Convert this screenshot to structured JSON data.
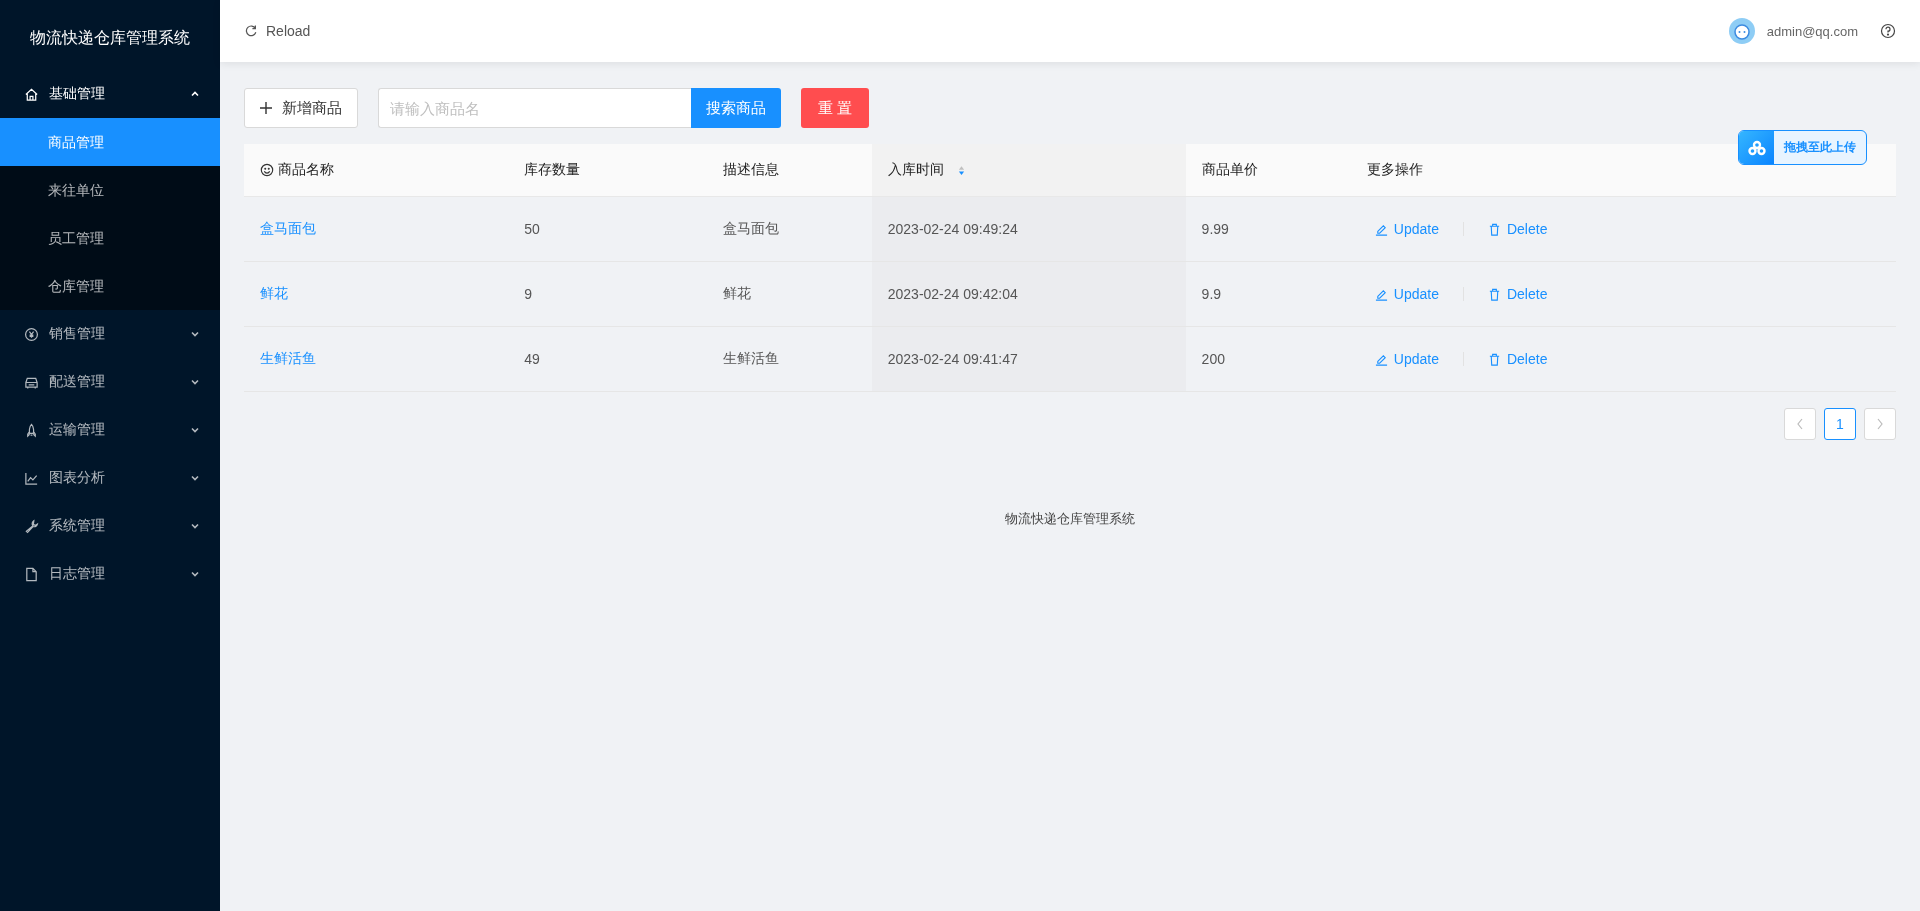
{
  "sidebar": {
    "title": "物流快递仓库管理系统",
    "menu": [
      {
        "label": "基础管理",
        "kind": "home",
        "expanded": true,
        "children": [
          {
            "label": "商品管理",
            "selected": true
          },
          {
            "label": "来往单位",
            "selected": false
          },
          {
            "label": "员工管理",
            "selected": false
          },
          {
            "label": "仓库管理",
            "selected": false
          }
        ]
      },
      {
        "label": "销售管理",
        "kind": "yen",
        "expanded": false
      },
      {
        "label": "配送管理",
        "kind": "car",
        "expanded": false
      },
      {
        "label": "运输管理",
        "kind": "rocket",
        "expanded": false
      },
      {
        "label": "图表分析",
        "kind": "chart",
        "expanded": false
      },
      {
        "label": "系统管理",
        "kind": "wrench",
        "expanded": false
      },
      {
        "label": "日志管理",
        "kind": "file",
        "expanded": false
      }
    ]
  },
  "header": {
    "reload": "Reload",
    "user": "admin@qq.com"
  },
  "toolbar": {
    "add_button": "新增商品",
    "search": {
      "placeholder": "请输入商品名"
    },
    "search_button": "搜索商品",
    "reset_button": "重 置"
  },
  "upload_widget": {
    "label": "拖拽至此上传"
  },
  "table": {
    "columns": [
      {
        "label": "商品名称",
        "kind": "smile"
      },
      {
        "label": "库存数量",
        "kind": "plain"
      },
      {
        "label": "描述信息",
        "kind": "plain"
      },
      {
        "label": "入库时间",
        "kind": "sortable"
      },
      {
        "label": "商品单价",
        "kind": "plain"
      },
      {
        "label": "更多操作",
        "kind": "plain"
      }
    ],
    "rows": [
      {
        "cells": [
          "盒马面包",
          "50",
          "盒马面包",
          "2023-02-24 09:49:24",
          "9.99"
        ],
        "actions": [
          {
            "label": "Update",
            "kind": "edit"
          },
          {
            "label": "Delete",
            "kind": "delete"
          }
        ]
      },
      {
        "cells": [
          "鲜花",
          "9",
          "鲜花",
          "2023-02-24 09:42:04",
          "9.9"
        ],
        "actions": [
          {
            "label": "Update",
            "kind": "edit"
          },
          {
            "label": "Delete",
            "kind": "delete"
          }
        ]
      },
      {
        "cells": [
          "生鲜活鱼",
          "49",
          "生鲜活鱼",
          "2023-02-24 09:41:47",
          "200"
        ],
        "actions": [
          {
            "label": "Update",
            "kind": "edit"
          },
          {
            "label": "Delete",
            "kind": "delete"
          }
        ]
      }
    ]
  },
  "pagination": {
    "pages": [
      {
        "label": "1",
        "selected": true
      }
    ]
  },
  "footer": "物流快递仓库管理系统"
}
